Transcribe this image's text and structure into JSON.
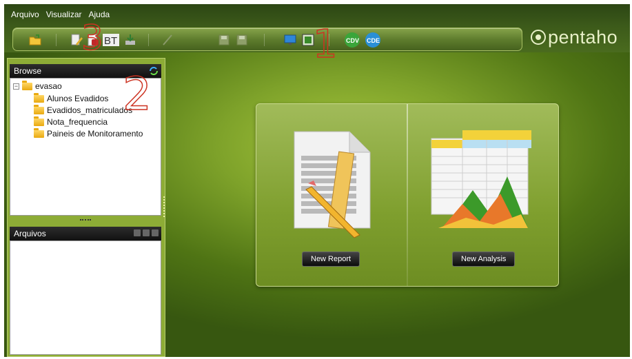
{
  "menu": {
    "items": [
      "Arquivo",
      "Visualizar",
      "Ajuda"
    ]
  },
  "logo": {
    "text": "pentaho"
  },
  "toolbar": {
    "icons": [
      "open-folder-icon",
      "edit-document-icon",
      "pdf-icon",
      "bt-icon",
      "export-icon",
      "pencil-icon",
      "save-icon",
      "save-as-icon",
      "monitor-icon",
      "layout-icon",
      "cdv-icon",
      "cde-icon"
    ],
    "cdv_label": "CDV",
    "cde_label": "CDE",
    "bt_label": "BT"
  },
  "browse": {
    "title": "Browse",
    "root": "evasao",
    "folders": [
      "Alunos Evadidos",
      "Evadidos_matriculados",
      "Nota_frequencia",
      "Paineis de Monitoramento"
    ]
  },
  "files": {
    "title": "Arquivos"
  },
  "launch": {
    "new_report": "New Report",
    "new_analysis": "New Analysis"
  },
  "annotations": {
    "one": "1",
    "two": "2",
    "three": "3"
  },
  "colors": {
    "background_green": "#7ea22a",
    "toolbar_green": "#5f7d2e",
    "dark_header": "#111111",
    "folder_yellow": "#e9a90f",
    "cdv_green": "#3aa53a",
    "cde_blue": "#2a8fd6"
  }
}
